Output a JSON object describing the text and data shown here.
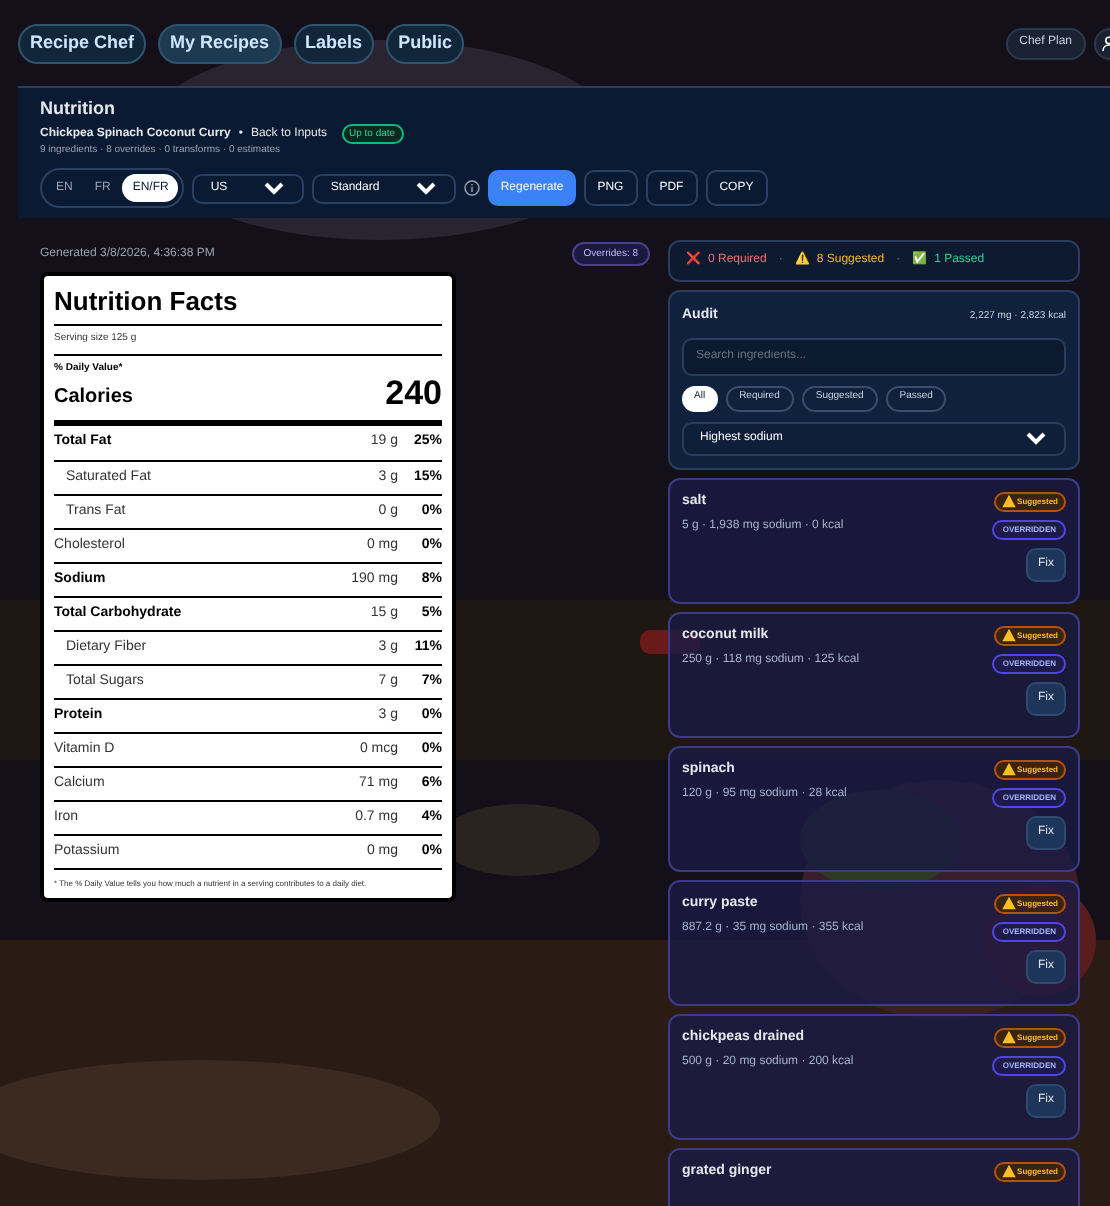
{
  "nav": {
    "links": [
      {
        "label": "Recipe Chef",
        "selected": false
      },
      {
        "label": "My Recipes",
        "selected": true
      },
      {
        "label": "Labels",
        "selected": false
      },
      {
        "label": "Public",
        "selected": false
      }
    ],
    "plan": "Chef Plan"
  },
  "header": {
    "title": "Nutrition",
    "recipe": "Chickpea Spinach Coconut Curry",
    "separator": "•",
    "back": "Back to Inputs",
    "status": "Up to date",
    "stats": "9 ingredients · 8 overrides · 0 transforms · 0 estimates"
  },
  "toolbar": {
    "languages": [
      {
        "label": "EN",
        "selected": false
      },
      {
        "label": "FR",
        "selected": false
      },
      {
        "label": "EN/FR",
        "selected": true
      }
    ],
    "region": "US",
    "format": "Standard",
    "actions": [
      {
        "label": "Regenerate",
        "kind": "primary"
      },
      {
        "label": "PNG",
        "kind": "outline"
      },
      {
        "label": "PDF",
        "kind": "outline"
      },
      {
        "label": "COPY",
        "kind": "outline"
      }
    ]
  },
  "generated": "Generated 3/8/2026, 4:36:38 PM",
  "overrides_badge": "Overrides: 8",
  "label": {
    "title": "Nutrition Facts",
    "serving": "Serving size 125 g",
    "dv_heading": "% Daily Value*",
    "calories_label": "Calories",
    "calories": "240",
    "rows": [
      {
        "name": "Total Fat",
        "amount": "19 g",
        "dv": "25%",
        "bold": true,
        "indent": false
      },
      {
        "name": "Saturated Fat",
        "amount": "3 g",
        "dv": "15%",
        "bold": false,
        "indent": true
      },
      {
        "name": "Trans Fat",
        "amount": "0 g",
        "dv": "0%",
        "bold": false,
        "indent": true
      },
      {
        "name": "Cholesterol",
        "amount": "0 mg",
        "dv": "0%",
        "bold": false,
        "indent": false
      },
      {
        "name": "Sodium",
        "amount": "190 mg",
        "dv": "8%",
        "bold": true,
        "indent": false
      },
      {
        "name": "Total Carbohydrate",
        "amount": "15 g",
        "dv": "5%",
        "bold": true,
        "indent": false
      },
      {
        "name": "Dietary Fiber",
        "amount": "3 g",
        "dv": "11%",
        "bold": false,
        "indent": true
      },
      {
        "name": "Total Sugars",
        "amount": "7 g",
        "dv": "7%",
        "bold": false,
        "indent": true
      },
      {
        "name": "Protein",
        "amount": "3 g",
        "dv": "0%",
        "bold": true,
        "indent": false
      },
      {
        "name": "Vitamin D",
        "amount": "0 mcg",
        "dv": "0%",
        "bold": false,
        "indent": false
      },
      {
        "name": "Calcium",
        "amount": "71 mg",
        "dv": "6%",
        "bold": false,
        "indent": false
      },
      {
        "name": "Iron",
        "amount": "0.7 mg",
        "dv": "4%",
        "bold": false,
        "indent": false
      },
      {
        "name": "Potassium",
        "amount": "0 mg",
        "dv": "0%",
        "bold": false,
        "indent": false
      }
    ],
    "footnote": "* The % Daily Value tells you how much a nutrient in a serving contributes to a daily diet."
  },
  "summary": [
    {
      "icon": "❌",
      "text": "0 Required",
      "color": "#f87171"
    },
    {
      "icon": "⚠️",
      "text": "8 Suggested",
      "color": "#fbbf24"
    },
    {
      "icon": "✅",
      "text": "1 Passed",
      "color": "#34d399"
    }
  ],
  "summary_sep": "·",
  "audit": {
    "title": "Audit",
    "totals": "2,227 mg · 2,823 kcal",
    "placeholder": "Search ingredients...",
    "filters": [
      {
        "label": "All",
        "selected": true
      },
      {
        "label": "Required",
        "selected": false
      },
      {
        "label": "Suggested",
        "selected": false
      },
      {
        "label": "Passed",
        "selected": false
      }
    ],
    "sort": "Highest sodium"
  },
  "ingredients": [
    {
      "name": "salt",
      "meta": "5 g · 1,938 mg sodium · 0 kcal",
      "badge": "Suggested",
      "overridden": true,
      "fix": "Fix",
      "override_label": "OVERRIDDEN"
    },
    {
      "name": "coconut milk",
      "meta": "250 g · 118 mg sodium · 125 kcal",
      "badge": "Suggested",
      "overridden": true,
      "fix": "Fix",
      "override_label": "OVERRIDDEN"
    },
    {
      "name": "spinach",
      "meta": "120 g · 95 mg sodium · 28 kcal",
      "badge": "Suggested",
      "overridden": true,
      "fix": "Fix",
      "override_label": "OVERRIDDEN"
    },
    {
      "name": "curry paste",
      "meta": "887.2 g · 35 mg sodium · 355 kcal",
      "badge": "Suggested",
      "overridden": true,
      "fix": "Fix",
      "override_label": "OVERRIDDEN"
    },
    {
      "name": "chickpeas drained",
      "meta": "500 g · 20 mg sodium · 200 kcal",
      "badge": "Suggested",
      "overridden": true,
      "fix": "Fix",
      "override_label": "OVERRIDDEN"
    },
    {
      "name": "grated ginger",
      "badge": "Suggested",
      "overridden": false
    }
  ]
}
